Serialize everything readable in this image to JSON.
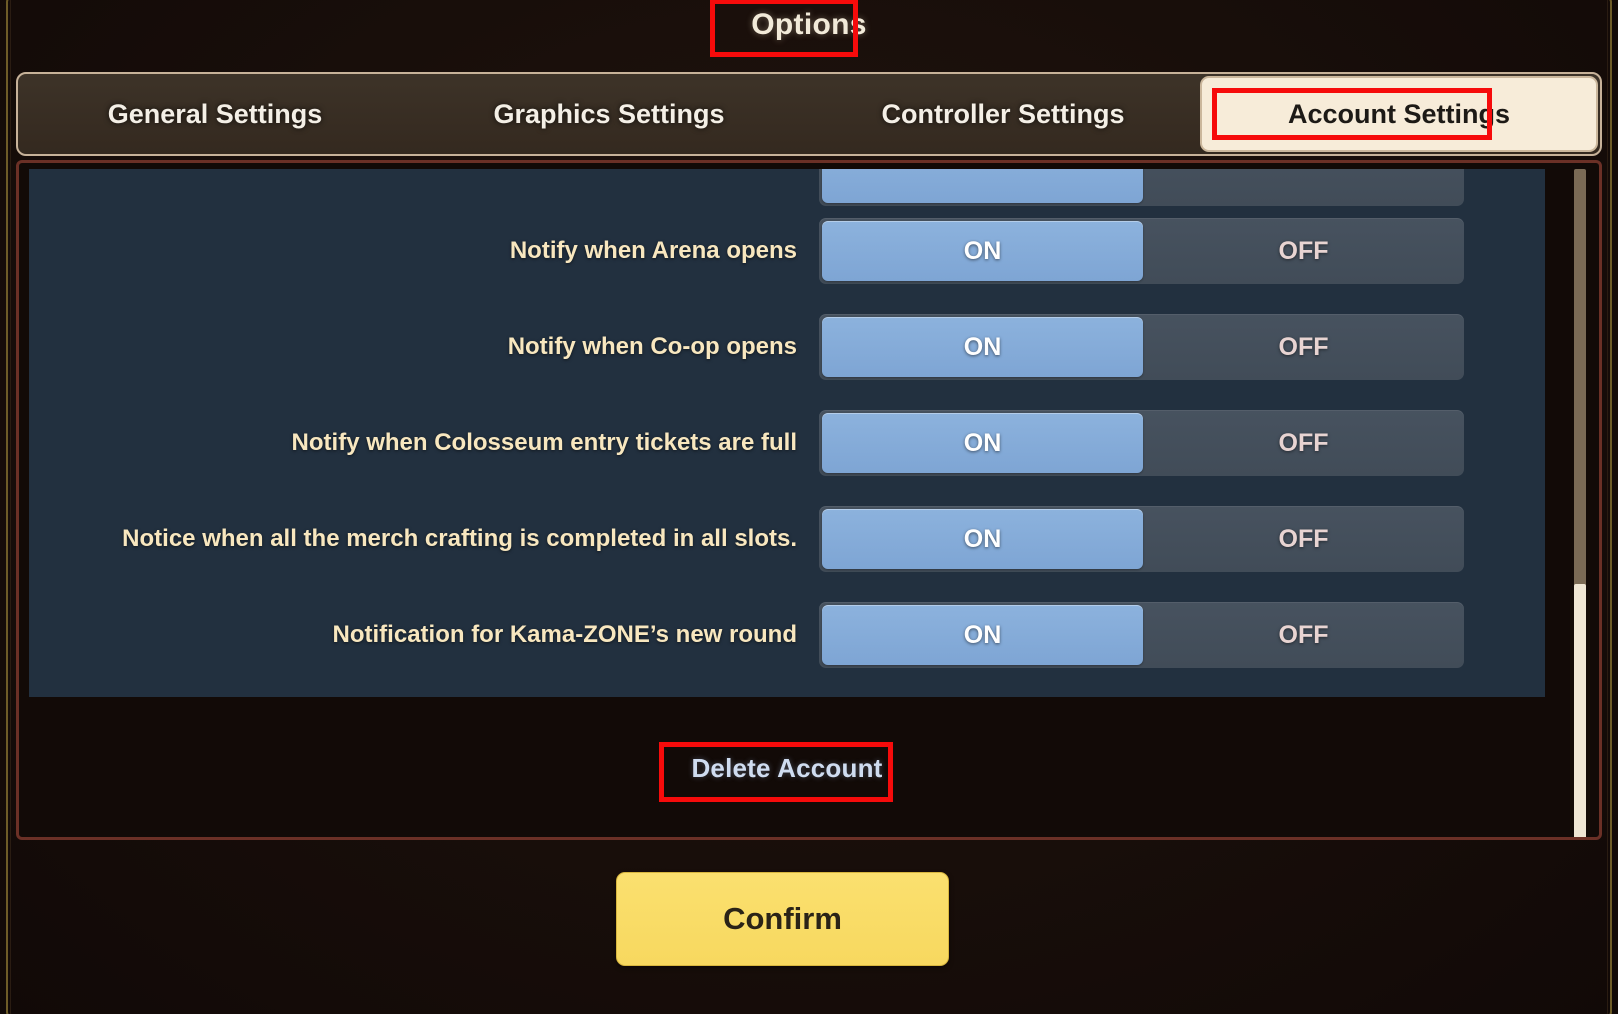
{
  "window": {
    "title": "Options"
  },
  "tabs": [
    {
      "label": "General Settings",
      "active": false
    },
    {
      "label": "Graphics Settings",
      "active": false
    },
    {
      "label": "Controller Settings",
      "active": false
    },
    {
      "label": "Account Settings",
      "active": true
    }
  ],
  "settings_rows": [
    {
      "label": "Notify when Arena opens",
      "value": "ON",
      "on_label": "ON",
      "off_label": "OFF"
    },
    {
      "label": "Notify when Co-op opens",
      "value": "ON",
      "on_label": "ON",
      "off_label": "OFF"
    },
    {
      "label": "Notify when Colosseum entry tickets are full",
      "value": "ON",
      "on_label": "ON",
      "off_label": "OFF"
    },
    {
      "label": "Notice when all the merch crafting is completed in all slots.",
      "value": "ON",
      "on_label": "ON",
      "off_label": "OFF"
    },
    {
      "label": "Notification for Kama-ZONE’s new round",
      "value": "ON",
      "on_label": "ON",
      "off_label": "OFF"
    }
  ],
  "footer": {
    "delete_account_label": "Delete Account",
    "confirm_label": "Confirm"
  },
  "scrollbar": {
    "thumb_position_percent": 60
  },
  "colors": {
    "accent_gold": "#f8e7bf",
    "toggle_on": "#8cb2dd",
    "toggle_track": "#47525f",
    "panel_background": "#22303f",
    "confirm_button": "#fbe06f",
    "active_tab_background": "#f7ecd9",
    "annotation_red": "#f60b0b",
    "delete_link": "#cfdcf0"
  }
}
